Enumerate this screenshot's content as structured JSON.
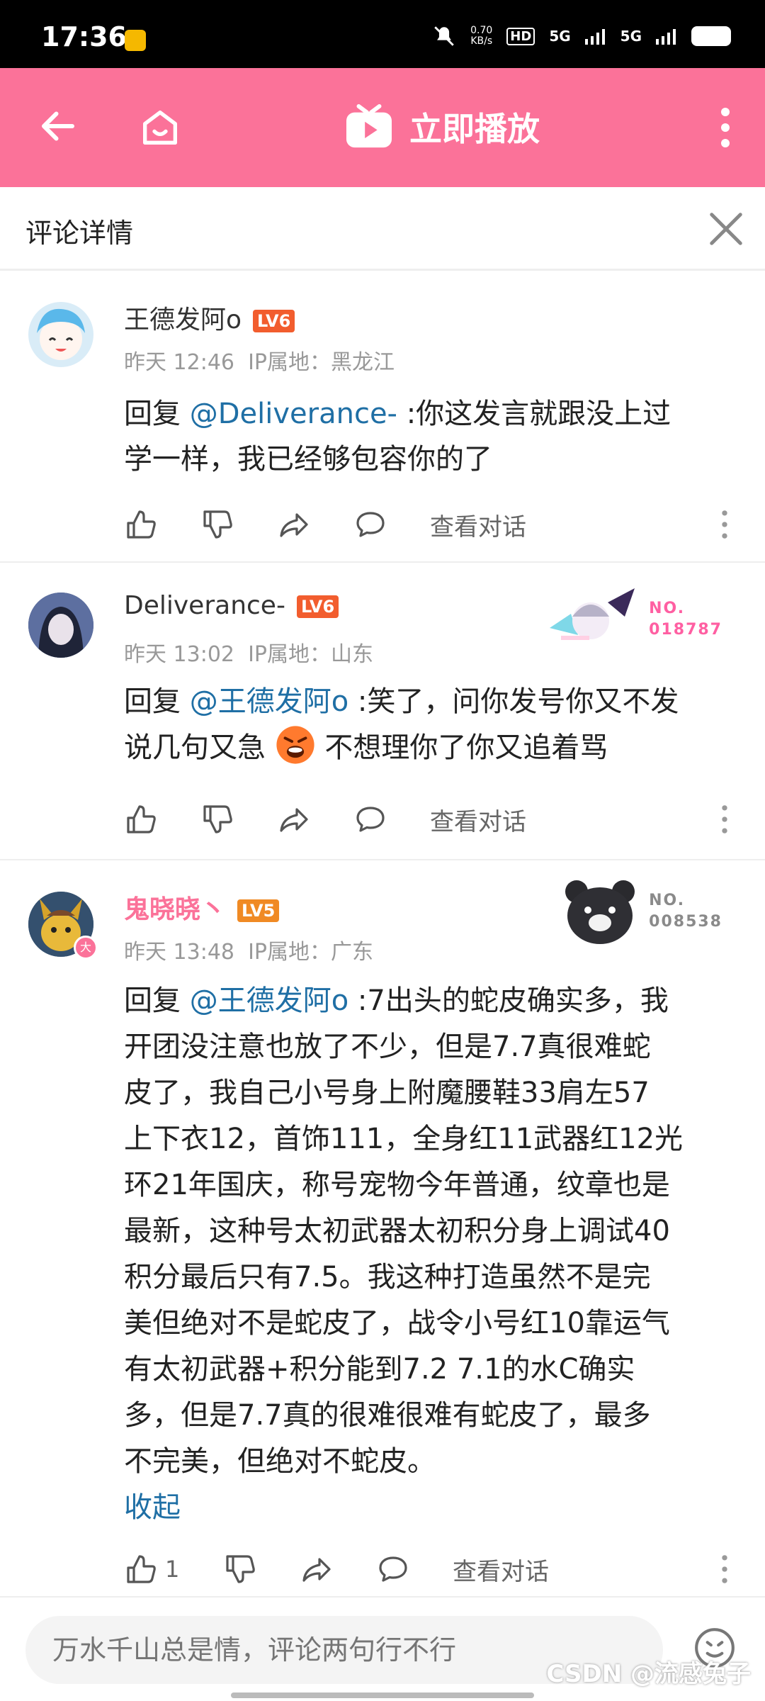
{
  "statusbar": {
    "time": "17:36",
    "speed": "0.70\nKB/s",
    "net1": "5G",
    "net2": "5G"
  },
  "appbar": {
    "play_label": "立即播放"
  },
  "detail": {
    "title": "评论详情"
  },
  "comments": [
    {
      "username": "王德发阿o",
      "level": "LV6",
      "meta": "昨天 12:46  IP属地：黑龙江",
      "prefix": "回复 ",
      "mention": "@Deliverance-",
      "text_line1": " :你这发言就跟没上过",
      "text_line2": "学一样，我已经够包容你的了",
      "view_label": "查看对话"
    },
    {
      "username": "Deliverance-",
      "level": "LV6",
      "meta": "昨天 13:02  IP属地：山东",
      "fan_no_label": "NO.",
      "fan_no": "018787",
      "prefix": "回复 ",
      "mention": "@王德发阿o",
      "text_line1": " :笑了，问你发号你又不发",
      "text_line2a": "说几句又急 ",
      "text_line2b": " 不想理你了你又追着骂",
      "view_label": "查看对话"
    },
    {
      "username": "鬼晓晓丶",
      "level": "LV5",
      "meta": "昨天 13:48  IP属地：广东",
      "fan_no_label": "NO.",
      "fan_no": "008538",
      "prefix": "回复 ",
      "mention": "@王德发阿o",
      "lines": [
        " :7出头的蛇皮确实多，我",
        "开团没注意也放了不少，但是7.7真很难蛇",
        "皮了，我自己小号身上附魔腰鞋33肩左57",
        "上下衣12，首饰111，全身红11武器红12光",
        "环21年国庆，称号宠物今年普通，纹章也是",
        "最新，这种号太初武器太初积分身上调试40",
        "积分最后只有7.5。我这种打造虽然不是完",
        "美但绝对不是蛇皮了，战令小号红10靠运气",
        "有太初武器+积分能到7.2 7.1的水C确实",
        "多，但是7.7真的很难很难有蛇皮了，最多",
        "不完美，但绝对不蛇皮。"
      ],
      "collapse_label": "收起",
      "like_count": "1",
      "view_label": "查看对话"
    }
  ],
  "input": {
    "placeholder": "万水千山总是情，评论两句行不行"
  },
  "watermark": "CSDN @流感兔子",
  "colors": {
    "brand": "#fb7299",
    "mention": "#1f6fa5",
    "lv6": "#f25d2e",
    "lv5": "#f08a24"
  }
}
